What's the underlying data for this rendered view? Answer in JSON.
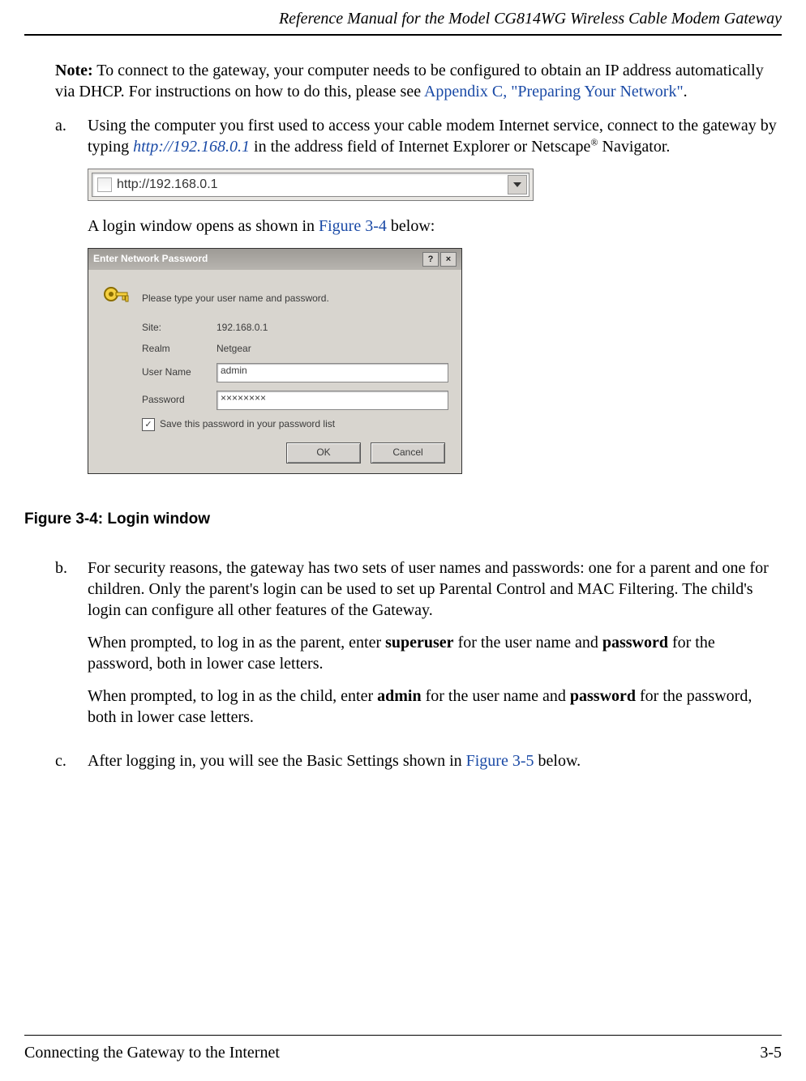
{
  "header": {
    "title": "Reference Manual for the Model CG814WG Wireless Cable Modem Gateway"
  },
  "note": {
    "label": "Note:",
    "text_before_link": " To connect to the gateway, your computer needs to be configured to obtain an IP address automatically via DHCP. For instructions on how to do this, please see ",
    "link": "Appendix C, \"Preparing Your Network\"",
    "text_after_link": "."
  },
  "step_a": {
    "marker": "a.",
    "text_before": "Using the computer you first used to access your cable modem Internet service, connect to the gateway by typing ",
    "url": "http://192.168.0.1",
    "text_after": " in the address field of Internet Explorer or Netscape",
    "reg": "®",
    "text_tail": " Navigator.",
    "addr_value": "http://192.168.0.1",
    "login_text_before": "A login window opens as shown in ",
    "login_fig_link": "Figure 3-4",
    "login_text_after": " below:"
  },
  "dialog": {
    "title": "Enter Network Password",
    "help_btn": "?",
    "close_btn": "×",
    "prompt": "Please type your user name and password.",
    "site_label": "Site:",
    "site_value": "192.168.0.1",
    "realm_label": "Realm",
    "realm_value": "Netgear",
    "user_label": "User Name",
    "user_value": "admin",
    "pass_label": "Password",
    "pass_value": "××××××××",
    "save_label": "Save this password in your password list",
    "checkmark": "✓",
    "ok": "OK",
    "cancel": "Cancel"
  },
  "figure_caption": "Figure 3-4: Login window",
  "step_b": {
    "marker": "b.",
    "p1": "For security reasons, the gateway has two sets of user names and passwords: one for a parent and one for children. Only the parent's login can be used to set up Parental Control and MAC Filtering. The child's login can configure all other features of the Gateway.",
    "p2_before": "When prompted, to log in as the parent, enter ",
    "p2_b1": "superuser",
    "p2_mid": " for the user name and ",
    "p2_b2": "password",
    "p2_after": " for the password, both in lower case letters.",
    "p3_before": "When prompted, to log in as the child, enter ",
    "p3_b1": "admin",
    "p3_mid": " for the user name and ",
    "p3_b2": "password",
    "p3_after": " for the password, both in lower case letters."
  },
  "step_c": {
    "marker": "c.",
    "text_before": "After logging in, you will see the Basic Settings shown in ",
    "link": "Figure 3-5",
    "text_after": " below."
  },
  "footer": {
    "left": "Connecting the Gateway to the Internet",
    "right": "3-5"
  }
}
